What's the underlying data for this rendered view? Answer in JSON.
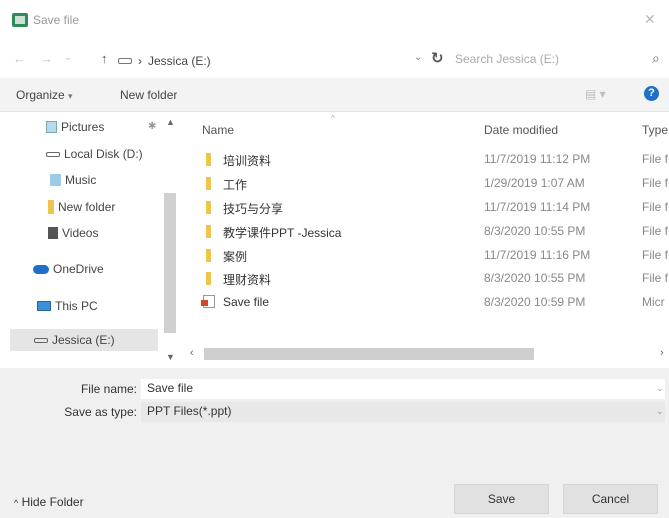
{
  "window": {
    "title": "Save file",
    "close_glyph": "✕"
  },
  "nav": {
    "back_glyph": "←",
    "forward_glyph": "→",
    "recent_glyph": "⌄",
    "up_glyph": "↑",
    "address": {
      "separator": "›",
      "location": "Jessica (E:)"
    },
    "dropdown_glyph": "⌄",
    "refresh_glyph": "↻",
    "search_placeholder": "Search Jessica (E:)",
    "search_glyph": "⌕"
  },
  "toolbar": {
    "organize": "Organize",
    "organize_caret": "▾",
    "new_folder": "New folder",
    "view_glyph": "▤ ▾",
    "help_glyph": "?"
  },
  "sidebar": {
    "items": [
      {
        "label": "Pictures",
        "icon": "pictures-icon"
      },
      {
        "label": "Local Disk (D:)",
        "icon": "drive-icon"
      },
      {
        "label": "Music",
        "icon": "music-icon"
      },
      {
        "label": "New folder",
        "icon": "folder-icon"
      },
      {
        "label": "Videos",
        "icon": "videos-icon"
      },
      {
        "label": "OneDrive",
        "icon": "cloud-icon"
      },
      {
        "label": "This PC",
        "icon": "pc-icon"
      },
      {
        "label": "Jessica (E:)",
        "icon": "drive-icon",
        "selected": true
      }
    ],
    "pin_glyph": "✱",
    "scroll_up_glyph": "▲",
    "scroll_down_glyph": "▼"
  },
  "files": {
    "columns": {
      "name": "Name",
      "date": "Date modified",
      "type": "Type"
    },
    "sort_glyph": "^",
    "rows": [
      {
        "name": "培训资料",
        "date": "11/7/2019 11:12 PM",
        "type": "File f",
        "icon": "folder-icon"
      },
      {
        "name": "工作",
        "date": "1/29/2019 1:07 AM",
        "type": "File f",
        "icon": "folder-icon"
      },
      {
        "name": "技巧与分享",
        "date": "11/7/2019 11:14 PM",
        "type": "File f",
        "icon": "folder-icon"
      },
      {
        "name": "教学课件PPT -Jessica",
        "date": "8/3/2020 10:55 PM",
        "type": "File f",
        "icon": "folder-icon"
      },
      {
        "name": "案例",
        "date": "11/7/2019 11:16 PM",
        "type": "File f",
        "icon": "folder-icon"
      },
      {
        "name": "理财资料",
        "date": "8/3/2020 10:55 PM",
        "type": "File f",
        "icon": "folder-icon"
      },
      {
        "name": "Save file",
        "date": "8/3/2020 10:59 PM",
        "type": "Micr",
        "icon": "ppt-icon"
      }
    ],
    "hscroll": {
      "left_glyph": "‹",
      "right_glyph": "›"
    }
  },
  "save_form": {
    "file_name_label": "File name:",
    "file_name_value": "Save file",
    "save_type_label": "Save as type:",
    "save_type_value": "PPT Files(*.ppt)",
    "dropdown_glyph": "⌄"
  },
  "footer": {
    "hide_folder": "Hide Folder",
    "hide_caret": "^",
    "save_button": "Save",
    "cancel_button": "Cancel"
  }
}
